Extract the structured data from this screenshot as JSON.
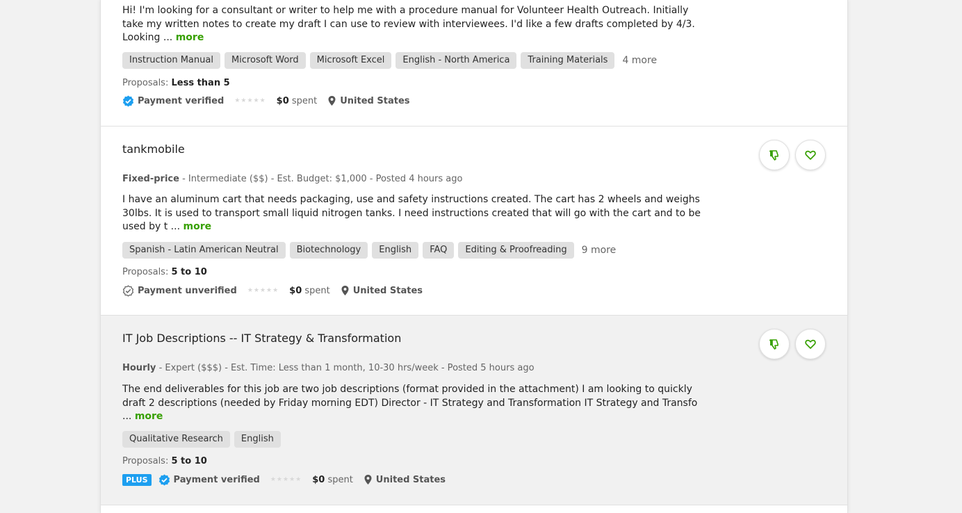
{
  "colors": {
    "accent_green": "#37a000",
    "verified_blue": "#1d9ff0",
    "tag_bg": "#e0e0e0",
    "muted_text": "#656565"
  },
  "more_label": "more",
  "jobs": [
    {
      "description": "Hi! I'm looking for a consultant or writer to help me with a procedure manual for Volunteer Health Outreach. Initially take my written notes to create my draft I can use to review with interviewees. I'd like a few drafts completed by 4/3. Looking ...",
      "tags": [
        "Instruction Manual",
        "Microsoft Word",
        "Microsoft Excel",
        "English - North America",
        "Training Materials"
      ],
      "tags_more": "4 more",
      "proposals_label": "Proposals:",
      "proposals_value": "Less than 5",
      "payment_icon": "verified-check-icon",
      "payment_status": "Payment verified",
      "rating_stars": 0,
      "spent_amount": "$0",
      "spent_label": "spent",
      "location_icon": "map-pin-icon",
      "location": "United States"
    },
    {
      "title": "tankmobile",
      "project_type": "Fixed-price",
      "meta_rest": "- Intermediate ($$) - Est. Budget: $1,000 - Posted 4 hours ago",
      "description": "I have an aluminum cart that needs packaging, use and safety instructions created. The cart has 2 wheels and weighs 30lbs. It is used to transport small liquid nitrogen tanks. I need instructions created that will go with the cart and to be used by t ...",
      "tags": [
        "Spanish - Latin American Neutral",
        "Biotechnology",
        "English",
        "FAQ",
        "Editing & Proofreading"
      ],
      "tags_more": "9 more",
      "proposals_label": "Proposals:",
      "proposals_value": "5 to 10",
      "payment_icon": "unverified-check-icon",
      "payment_status": "Payment unverified",
      "rating_stars": 0,
      "spent_amount": "$0",
      "spent_label": "spent",
      "location_icon": "map-pin-icon",
      "location": "United States",
      "dislike_icon": "thumbs-down-icon",
      "save_icon": "heart-icon"
    },
    {
      "title": "IT Job Descriptions -- IT Strategy & Transformation",
      "project_type": "Hourly",
      "meta_rest": "- Expert ($$$) - Est. Time: Less than 1 month, 10-30 hrs/week - Posted 5 hours ago",
      "description": "The end deliverables for this job are two job descriptions (format provided in the attachment) I am looking to quickly draft 2 descriptions (needed by Friday morning EDT) Director - IT Strategy and Transformation IT Strategy and Transfo ...",
      "tags": [
        "Qualitative Research",
        "English"
      ],
      "proposals_label": "Proposals:",
      "proposals_value": "5 to 10",
      "plus_badge": "PLUS",
      "payment_icon": "verified-check-icon",
      "payment_status": "Payment verified",
      "rating_stars": 0,
      "spent_amount": "$0",
      "spent_label": "spent",
      "location_icon": "map-pin-icon",
      "location": "United States",
      "dislike_icon": "thumbs-down-icon",
      "save_icon": "heart-icon"
    }
  ]
}
